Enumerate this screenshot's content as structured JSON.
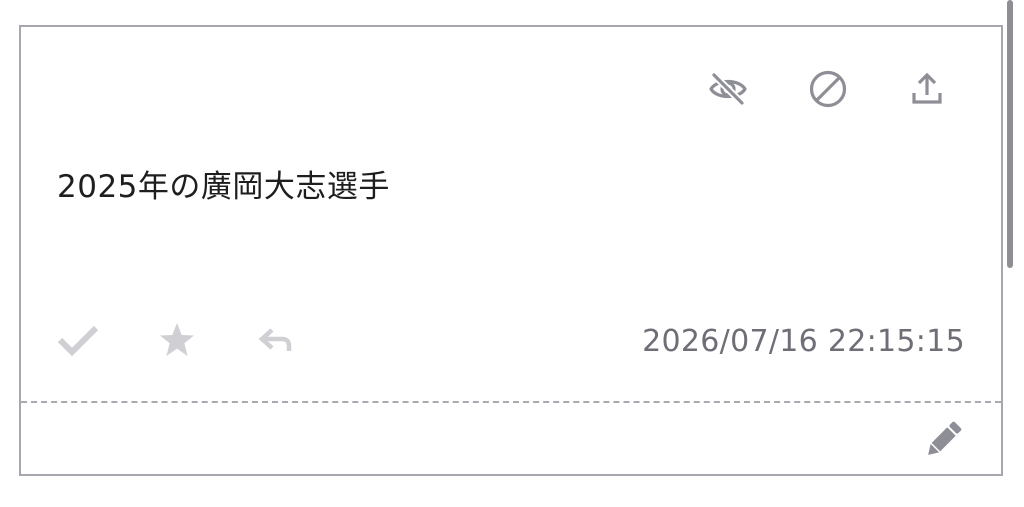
{
  "message": {
    "text": "2025年の廣岡大志選手",
    "timestamp": "2026/07/16 22:15:15"
  },
  "top_actions": [
    {
      "icon": "eye-off-icon",
      "action": "hide"
    },
    {
      "icon": "block-icon",
      "action": "block"
    },
    {
      "icon": "upload-icon",
      "action": "share"
    }
  ],
  "bottom_actions": [
    {
      "icon": "check-icon",
      "action": "mark-read"
    },
    {
      "icon": "star-icon",
      "action": "favorite"
    },
    {
      "icon": "reply-icon",
      "action": "reply"
    }
  ],
  "edit": {
    "icon": "pencil-icon"
  },
  "colors": {
    "border": "#a7a7b0",
    "text": "#1e1e1e",
    "muted_text": "#6e6e76",
    "icon_dark": "#8e8e96",
    "icon_light": "#cfcfd4"
  }
}
